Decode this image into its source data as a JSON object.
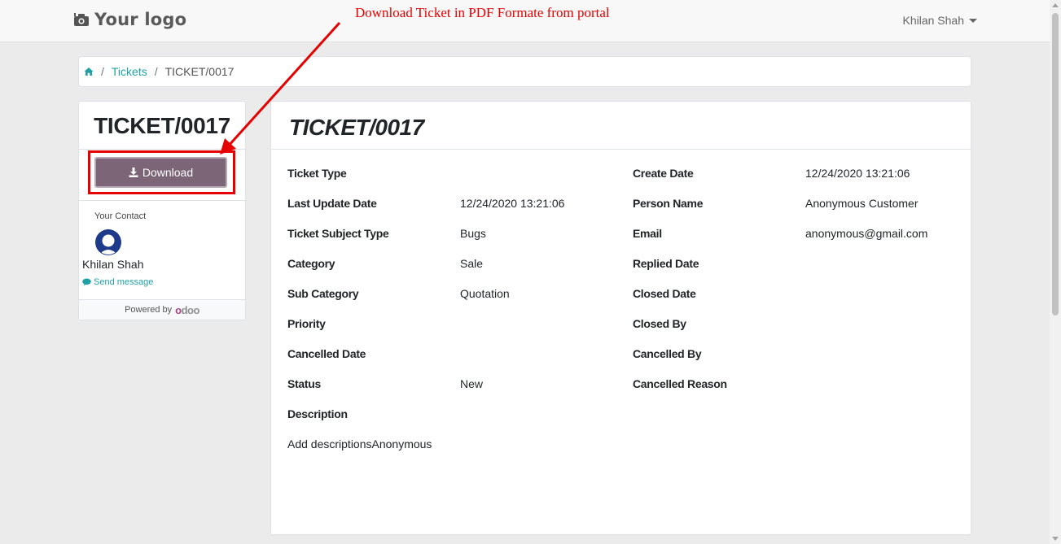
{
  "header": {
    "logo_text": "Your logo",
    "user_name": "Khilan Shah"
  },
  "annotation": {
    "text": "Download Ticket in PDF Formate from portal",
    "color": "#e60000"
  },
  "breadcrumb": {
    "home_icon": "home-icon",
    "items": [
      "Tickets",
      "TICKET/0017"
    ]
  },
  "sidebar": {
    "title": "TICKET/0017",
    "download_label": "Download",
    "contact_label": "Your Contact",
    "contact_name": "Khilan Shah",
    "send_message_label": "Send message",
    "powered_by_label": "Powered by",
    "powered_brand": "odoo"
  },
  "ticket": {
    "title": "TICKET/0017",
    "left_fields": [
      {
        "label": "Ticket Type",
        "value": ""
      },
      {
        "label": "Last Update Date",
        "value": "12/24/2020 13:21:06"
      },
      {
        "label": "Ticket Subject Type",
        "value": "Bugs"
      },
      {
        "label": "Category",
        "value": "Sale"
      },
      {
        "label": "Sub Category",
        "value": "Quotation"
      },
      {
        "label": "Priority",
        "value": ""
      },
      {
        "label": "Cancelled Date",
        "value": ""
      },
      {
        "label": "Status",
        "value": "New"
      },
      {
        "label": "Description",
        "value": ""
      }
    ],
    "right_fields": [
      {
        "label": "Create Date",
        "value": "12/24/2020 13:21:06"
      },
      {
        "label": "Person Name",
        "value": "Anonymous Customer"
      },
      {
        "label": "Email",
        "value": "anonymous@gmail.com"
      },
      {
        "label": "Replied Date",
        "value": ""
      },
      {
        "label": "Closed Date",
        "value": ""
      },
      {
        "label": "Closed By",
        "value": ""
      },
      {
        "label": "Cancelled By",
        "value": ""
      },
      {
        "label": "Cancelled Reason",
        "value": ""
      }
    ],
    "description_text": "Add descriptionsAnonymous"
  },
  "colors": {
    "accent": "#21a1a6",
    "button": "#7c6577",
    "avatar": "#1e3a8a"
  }
}
